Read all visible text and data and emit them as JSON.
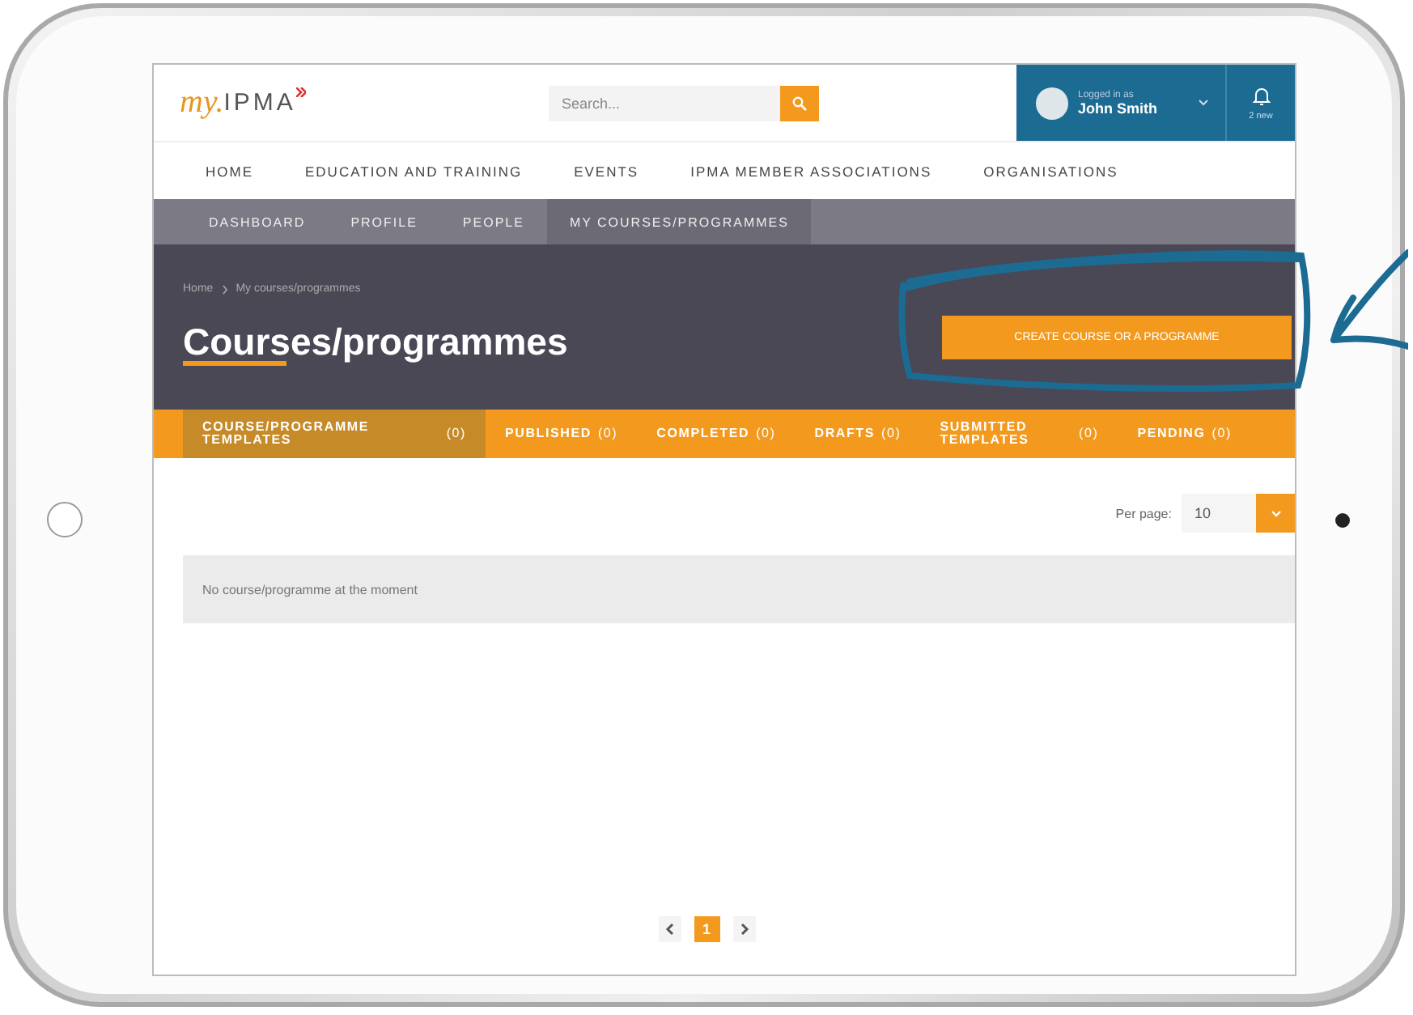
{
  "header": {
    "logo": {
      "text_1": "my.",
      "text_2": "IPMA"
    },
    "search": {
      "placeholder": "Search..."
    },
    "user": {
      "caption": "Logged in as",
      "name": "John Smith"
    },
    "notifications": {
      "caption": "2 new"
    }
  },
  "main_nav": [
    {
      "label": "HOME"
    },
    {
      "label": "EDUCATION AND TRAINING"
    },
    {
      "label": "EVENTS"
    },
    {
      "label": "IPMA MEMBER ASSOCIATIONS"
    },
    {
      "label": "ORGANISATIONS"
    }
  ],
  "sub_nav": [
    {
      "label": "DASHBOARD",
      "selected": false
    },
    {
      "label": "PROFILE",
      "selected": false
    },
    {
      "label": "PEOPLE",
      "selected": false
    },
    {
      "label": "MY COURSES/PROGRAMMES",
      "selected": true
    }
  ],
  "breadcrumb": [
    "Home",
    "My courses/programmes"
  ],
  "page_title": "Courses/programmes",
  "create_button": "CREATE COURSE OR A PROGRAMME",
  "tabs": [
    {
      "label": "COURSE/PROGRAMME TEMPLATES",
      "count": "(0)",
      "selected": true
    },
    {
      "label": "PUBLISHED",
      "count": "(0)",
      "selected": false
    },
    {
      "label": "COMPLETED",
      "count": "(0)",
      "selected": false
    },
    {
      "label": "DRAFTS",
      "count": "(0)",
      "selected": false
    },
    {
      "label": "SUBMITTED TEMPLATES",
      "count": "(0)",
      "selected": false
    },
    {
      "label": "PENDING",
      "count": "(0)",
      "selected": false
    }
  ],
  "per_page": {
    "label": "Per page:",
    "value": "10"
  },
  "empty_message": "No course/programme at the moment",
  "pagination": [
    {
      "label": "1",
      "selected": true
    }
  ]
}
